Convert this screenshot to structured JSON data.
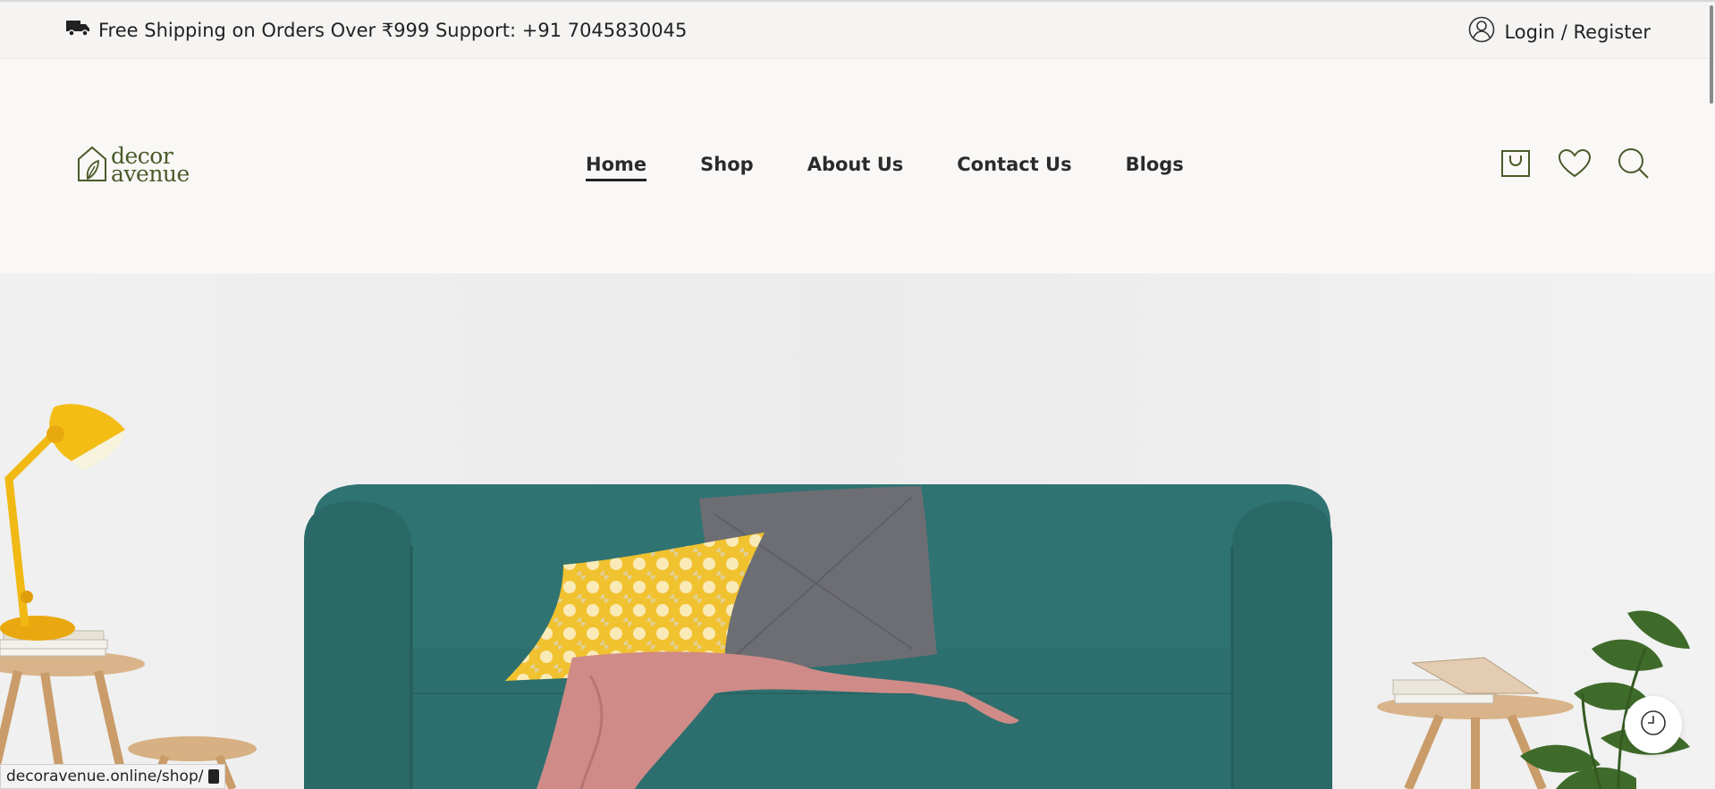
{
  "topbar": {
    "announcement": "Free Shipping on Orders Over ₹999 Support: +91 7045830045",
    "login": "Login / Register"
  },
  "logo": {
    "line1": "decor",
    "line2": "avenue"
  },
  "nav": [
    "Home",
    "Shop",
    "About Us",
    "Contact Us",
    "Blogs"
  ],
  "active_nav": "Home",
  "status_url": "decoravenue.online/shop/",
  "colors": {
    "brand": "#4a5a2a",
    "sofa": "#2f7372",
    "lamp": "#f0b914",
    "background": "#f9f8f6"
  },
  "icons": [
    "truck-icon",
    "user-icon",
    "bag-icon",
    "heart-icon",
    "search-icon",
    "history-icon"
  ]
}
